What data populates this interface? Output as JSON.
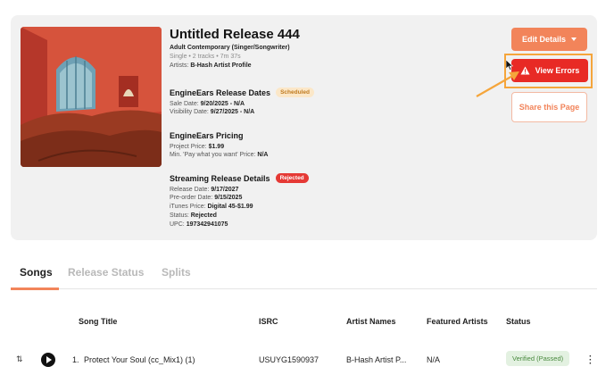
{
  "release": {
    "title": "Untitled Release 444",
    "genre": "Adult Contemporary (Singer/Songwriter)",
    "meta": "Single • 2 tracks • 7m 37s",
    "artists_label": "Artists:",
    "artists_value": "B-Hash Artist Profile"
  },
  "release_dates": {
    "heading": "EngineEars Release Dates",
    "badge": "Scheduled",
    "sale_label": "Sale Date:",
    "sale_value": "9/20/2025 - N/A",
    "visibility_label": "Visibility Date:",
    "visibility_value": "9/27/2025 - N/A"
  },
  "pricing": {
    "heading": "EngineEars Pricing",
    "project_label": "Project Price:",
    "project_value": "$1.99",
    "min_label": "Min. 'Pay what you want' Price:",
    "min_value": "N/A"
  },
  "streaming": {
    "heading": "Streaming Release Details",
    "badge": "Rejected",
    "release_label": "Release Date:",
    "release_value": "9/17/2027",
    "preorder_label": "Pre-order Date:",
    "preorder_value": "9/15/2025",
    "itunes_label": "iTunes Price:",
    "itunes_value": "Digital 45-$1.99",
    "status_label": "Status:",
    "status_value": "Rejected",
    "upc_label": "UPC:",
    "upc_value": "197342941075"
  },
  "actions": {
    "edit_label": "Edit Details",
    "errors_label": "View Errors",
    "share_label": "Share this Page"
  },
  "tabs": [
    {
      "label": "Songs"
    },
    {
      "label": "Release Status"
    },
    {
      "label": "Splits"
    }
  ],
  "table": {
    "headers": [
      "Song Title",
      "ISRC",
      "Artist Names",
      "Featured Artists",
      "Status"
    ],
    "rows": [
      {
        "number": "1.",
        "title": "Protect Your Soul (cc_Mix1) (1)",
        "isrc": "USUYG1590937",
        "artists": "B-Hash Artist P...",
        "featured": "N/A",
        "status": "Verified (Passed)"
      }
    ]
  },
  "colors": {
    "accent": "#f2845a",
    "error": "#e82a25",
    "highlight": "#f5a53b",
    "scheduled_bg": "#fbe7c8",
    "verified_bg": "#e3f1e1"
  },
  "icons": [
    "warning-icon",
    "caret-down-icon",
    "play-icon",
    "sort-icon",
    "more-vertical-icon",
    "cursor-icon",
    "arrow-annotation-icon"
  ]
}
